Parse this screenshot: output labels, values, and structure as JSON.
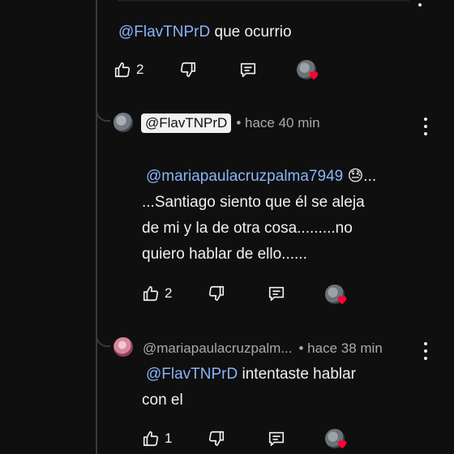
{
  "comments": [
    {
      "mention": "@FlavTNPrD",
      "text": "que ocurrio",
      "likes": "2"
    },
    {
      "author": "@FlavTNPrD",
      "time": "• hace 40 min",
      "mention": "@mariapaulacruzpalma7949",
      "emoji": "😓",
      "ellipsis": "...",
      "lines": [
        "...Santiago siento que él se aleja",
        "de mi y la de otra cosa.........no",
        "quiero hablar de ello......"
      ],
      "likes": "2"
    },
    {
      "author": "@mariapaulacruzpalm...",
      "time": "• hace 38 min",
      "mention": "@FlavTNPrD",
      "text_line1": " intentaste hablar",
      "text_line2": "con el",
      "likes": "1"
    }
  ],
  "colors": {
    "background": "#0f0f0f",
    "mention": "#8ab4f8",
    "meta": "#aaaaaa",
    "heart": "#ff0033"
  },
  "icons": [
    "like-icon",
    "dislike-icon",
    "reply-icon",
    "creator-heart-icon",
    "more-vert-icon"
  ]
}
